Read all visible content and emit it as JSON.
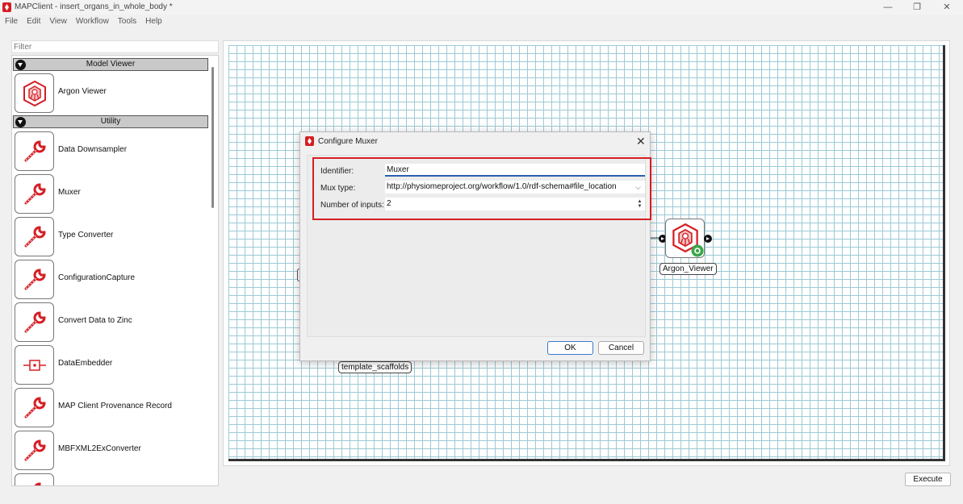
{
  "window": {
    "title": "MAPClient - insert_organs_in_whole_body *",
    "accent": "#d51e24",
    "controls": {
      "minimize": "—",
      "restore": "❐",
      "close": "✕"
    }
  },
  "menu": [
    "File",
    "Edit",
    "View",
    "Workflow",
    "Tools",
    "Help"
  ],
  "filter": {
    "placeholder": "Filter"
  },
  "palette": {
    "categories": [
      {
        "name": "Model Viewer",
        "steps": [
          {
            "label": "Argon Viewer",
            "icon": "argon-viewer-icon"
          }
        ]
      },
      {
        "name": "Utility",
        "steps": [
          {
            "label": "Data Downsampler",
            "icon": "wrench-icon"
          },
          {
            "label": "Muxer",
            "icon": "wrench-icon"
          },
          {
            "label": "Type Converter",
            "icon": "wrench-icon"
          },
          {
            "label": "ConfigurationCapture",
            "icon": "wrench-icon"
          },
          {
            "label": "Convert Data to Zinc",
            "icon": "wrench-icon"
          },
          {
            "label": "DataEmbedder",
            "icon": "embedder-icon"
          },
          {
            "label": "MAP Client Provenance Record",
            "icon": "wrench-icon"
          },
          {
            "label": "MBFXML2ExConverter",
            "icon": "wrench-icon"
          }
        ]
      }
    ]
  },
  "canvas": {
    "nodes": [
      {
        "label": "Argon_Viewer",
        "icon": "argon-viewer-icon"
      },
      {
        "label": "template_scaffolds"
      }
    ]
  },
  "dialog": {
    "title": "Configure Muxer",
    "close": "✕",
    "identifier_label": "Identifier:",
    "identifier_value": "Muxer",
    "mux_type_label": "Mux type:",
    "mux_type_value": "http://physiomeproject.org/workflow/1.0/rdf-schema#file_location",
    "inputs_label": "Number of inputs:",
    "inputs_value": "2",
    "ok": "OK",
    "cancel": "Cancel"
  },
  "execute": "Execute"
}
